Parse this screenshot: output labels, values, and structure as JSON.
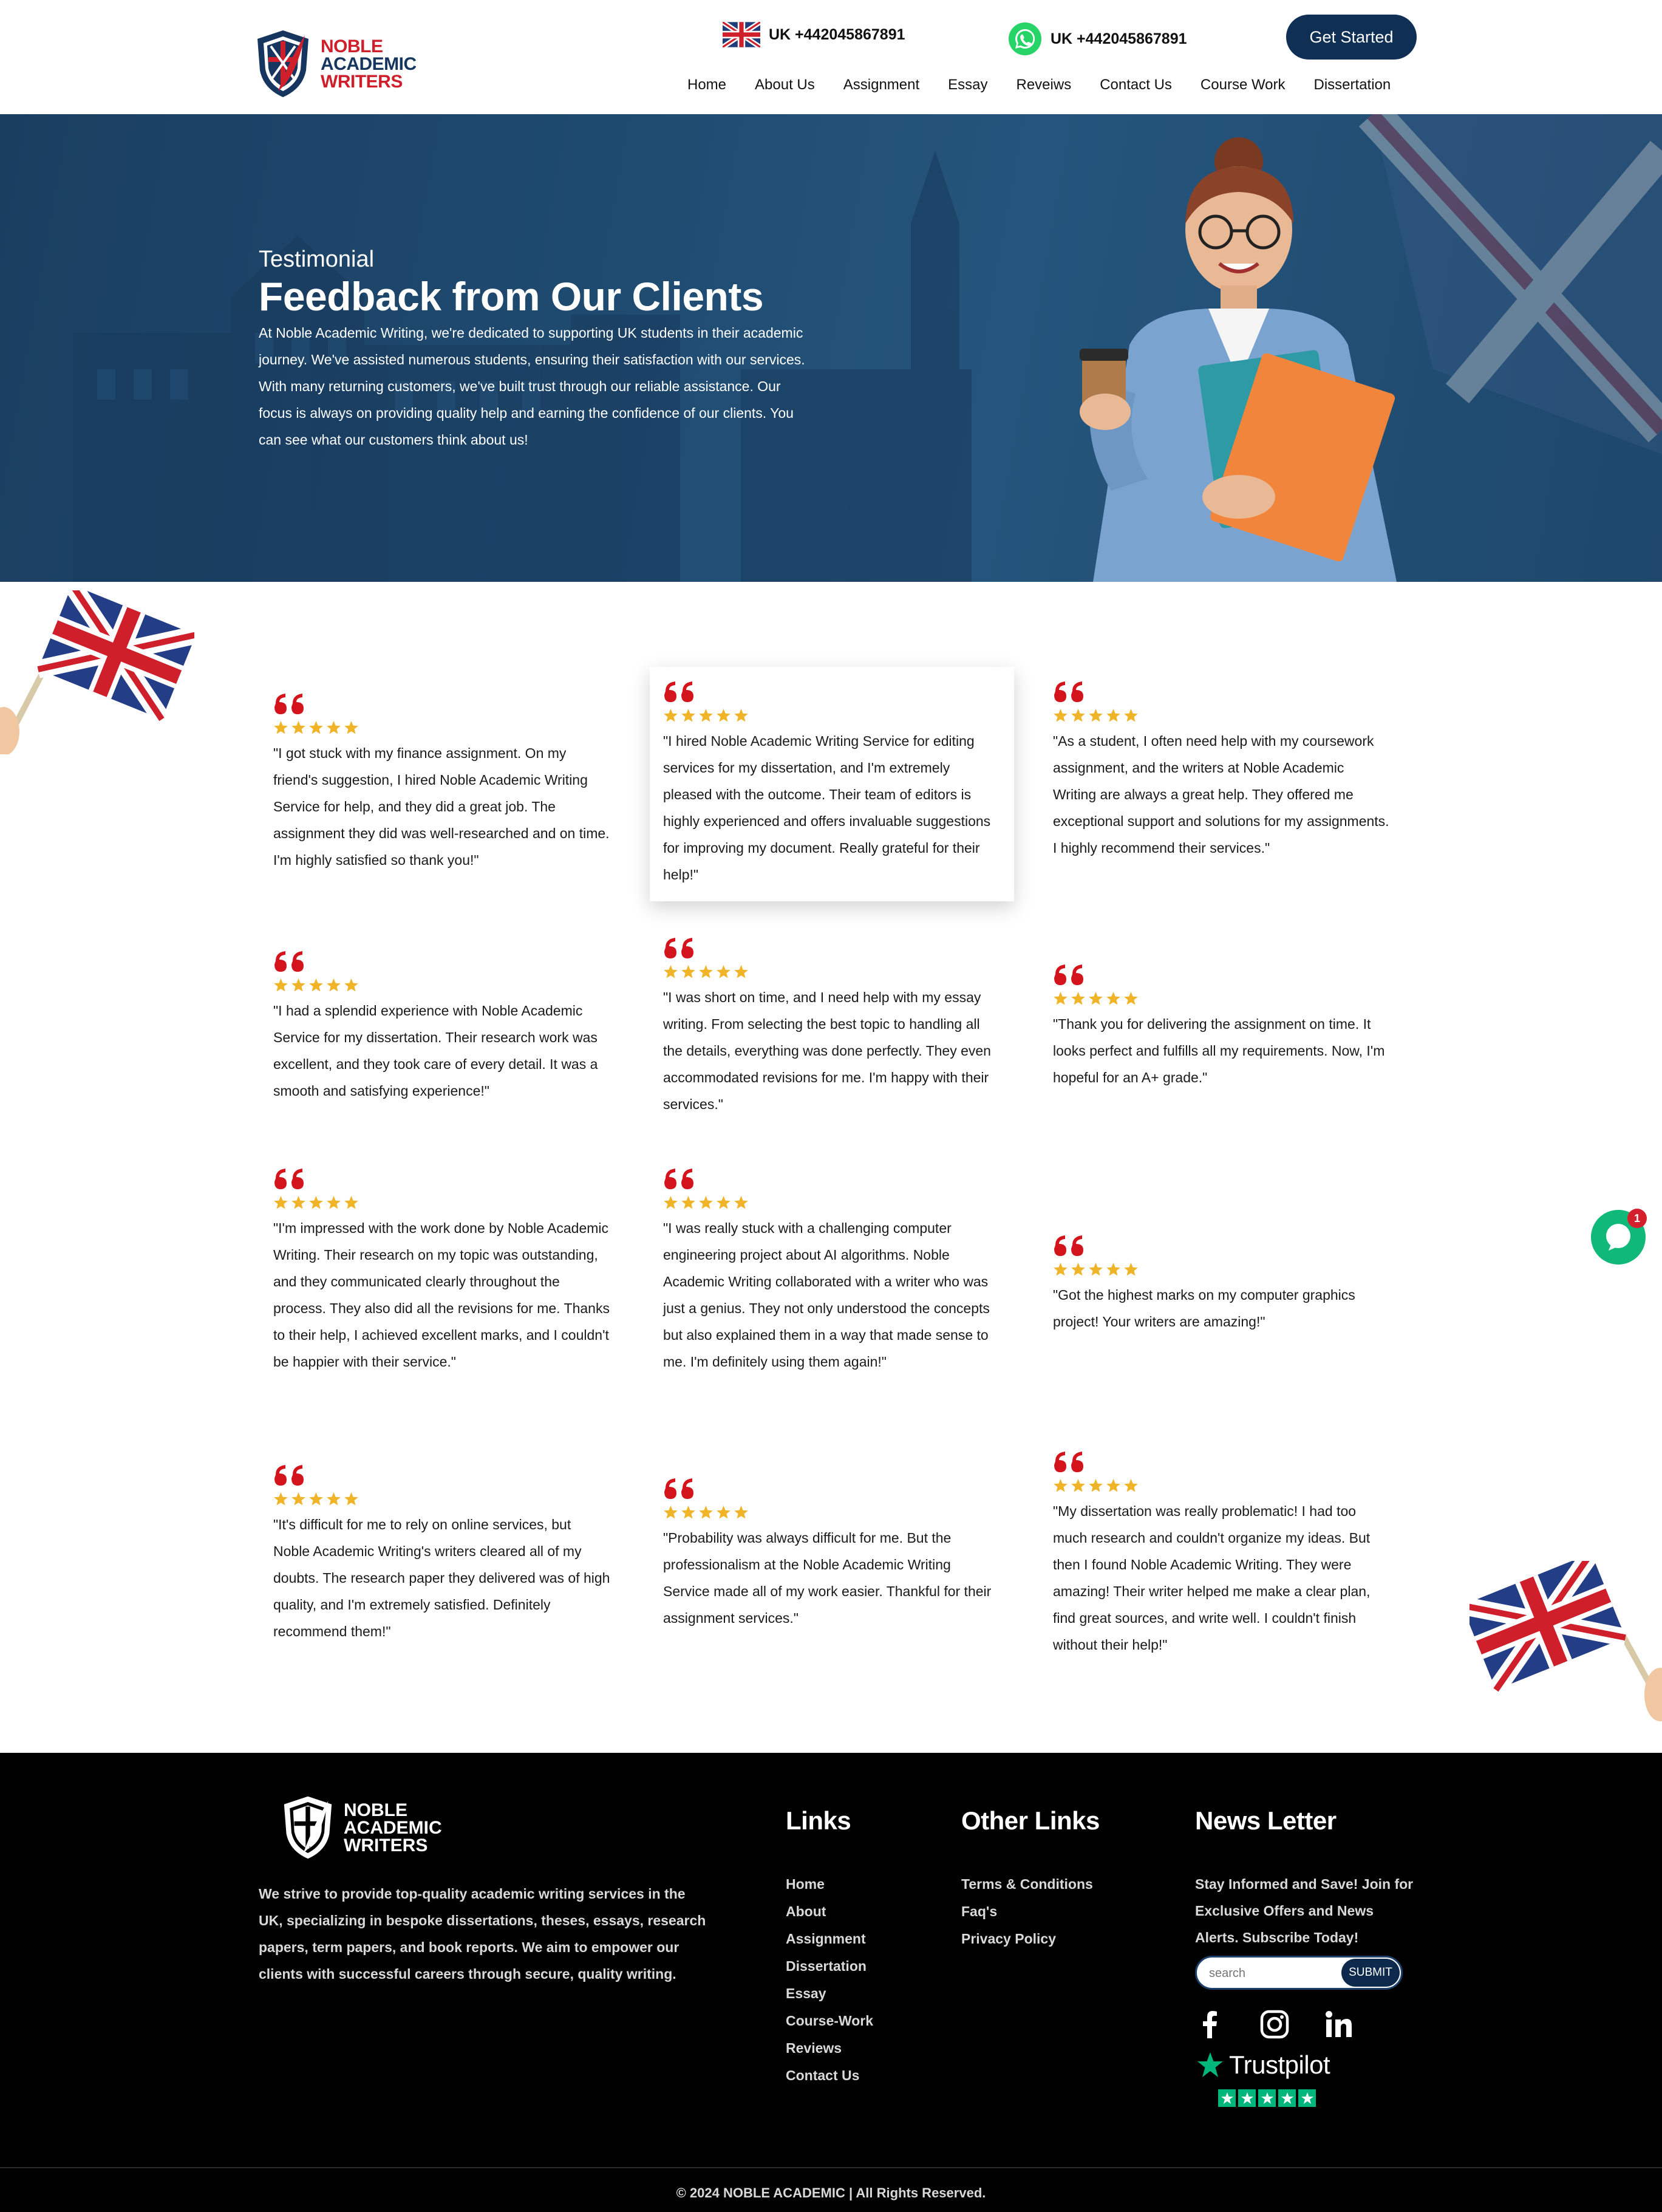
{
  "logo": {
    "line1": "NOBLE",
    "line2": "ACADEMIC",
    "line3": "WRITERS"
  },
  "header": {
    "phone_uk": "UK +442045867891",
    "phone_whatsapp": "UK +442045867891",
    "cta": "Get Started",
    "nav": [
      "Home",
      "About Us",
      "Assignment",
      "Essay",
      "Reveiws",
      "Contact Us",
      "Course Work",
      "Dissertation"
    ]
  },
  "hero": {
    "kicker": "Testimonial",
    "title": "Feedback from Our Clients",
    "text": "At Noble Academic Writing, we're dedicated to supporting UK students in their academic journey. We've assisted numerous students, ensuring their satisfaction with our services. With many returning customers, we've built trust through our reliable assistance. Our focus is always on providing quality help and earning the confidence of our clients. You can see what our customers think about us!"
  },
  "testimonials": [
    {
      "rating": 5,
      "text": "\"I got stuck with my finance assignment. On my friend's suggestion, I hired Noble Academic Writing Service for help, and they did a great job. The assignment they did was well-researched and on time. I'm highly satisfied so thank you!\""
    },
    {
      "rating": 5,
      "text": "\"I hired Noble Academic Writing Service for editing services for my dissertation, and I'm extremely pleased with the outcome. Their team of editors is highly experienced and offers invaluable suggestions for improving my document. Really grateful for their help!\""
    },
    {
      "rating": 5,
      "text": "\"As a student, I often need help with my coursework assignment, and the writers at Noble Academic Writing are always a great help. They offered me exceptional support and solutions for my assignments. I highly recommend their services.\""
    },
    {
      "rating": 5,
      "text": "\"I had a splendid experience with Noble Academic Service for my dissertation. Their research work was excellent, and they took care of every detail. It was a smooth and satisfying experience!\""
    },
    {
      "rating": 5,
      "text": "\"I was short on time, and I need help with my essay writing. From selecting the best topic to handling all the details, everything was done perfectly. They even accommodated revisions for me. I'm happy with their services.\""
    },
    {
      "rating": 5,
      "text": "\"Thank you for delivering the assignment on time. It looks perfect and fulfills all my requirements. Now, I'm hopeful for an A+ grade.\""
    },
    {
      "rating": 5,
      "text": "\"I'm impressed with the work done by Noble Academic Writing. Their research on my topic was outstanding, and they communicated clearly throughout the process. They also did all the revisions for me. Thanks to their help, I achieved excellent marks, and I couldn't be happier with their service.\""
    },
    {
      "rating": 5,
      "text": "\"I was really stuck with a challenging computer engineering project about AI algorithms. Noble Academic Writing collaborated with a writer who was just a genius. They not only understood the concepts but also explained them in a way that made sense to me. I'm definitely using them again!\""
    },
    {
      "rating": 5,
      "text": "\"Got the highest marks on my computer graphics project! Your writers are amazing!\""
    },
    {
      "rating": 5,
      "text": "\"It's difficult for me to rely on online services, but Noble Academic Writing's writers cleared all of my doubts. The research paper they delivered was of high quality, and I'm extremely satisfied. Definitely recommend them!\""
    },
    {
      "rating": 5,
      "text": "\"Probability was always difficult for me. But the professionalism at the Noble Academic Writing Service made all of my work easier. Thankful for their assignment services.\""
    },
    {
      "rating": 5,
      "text": "\"My dissertation was really problematic! I had too much research and couldn't organize my ideas. But then I found Noble Academic Writing. They were amazing! Their writer helped me make a clear plan, find great sources, and write well. I couldn't finish without their help!\""
    }
  ],
  "chat": {
    "badge": "1"
  },
  "footer": {
    "about": "We strive to provide top-quality academic writing services in the UK, specializing in bespoke dissertations, theses, essays, research papers, term papers, and book reports. We aim to empower our clients with successful careers through secure, quality writing.",
    "links_title": "Links",
    "links": [
      "Home",
      "About",
      "Assignment",
      "Dissertation",
      "Essay",
      "Course-Work",
      "Reviews",
      "Contact Us"
    ],
    "other_title": "Other Links",
    "other_links": [
      "Terms & Conditions",
      "Faq's",
      "Privacy Policy"
    ],
    "news_title": "News Letter",
    "news_text": "Stay Informed and Save! Join for Exclusive Offers and News Alerts. Subscribe Today!",
    "search_placeholder": "search",
    "submit": "SUBMIT",
    "social": [
      "facebook-icon",
      "instagram-icon",
      "linkedin-icon"
    ],
    "trustpilot": "Trustpilot",
    "trustpilot_rating": 5,
    "copyright": "© 2024 NOBLE ACADEMIC | All Rights Reserved."
  },
  "colors": {
    "navy": "#0f2f54",
    "red": "#cf1f2b",
    "star": "#f0b429",
    "quote": "#d4141c",
    "whatsapp": "#10b87a",
    "trustpilot": "#00b67a"
  }
}
